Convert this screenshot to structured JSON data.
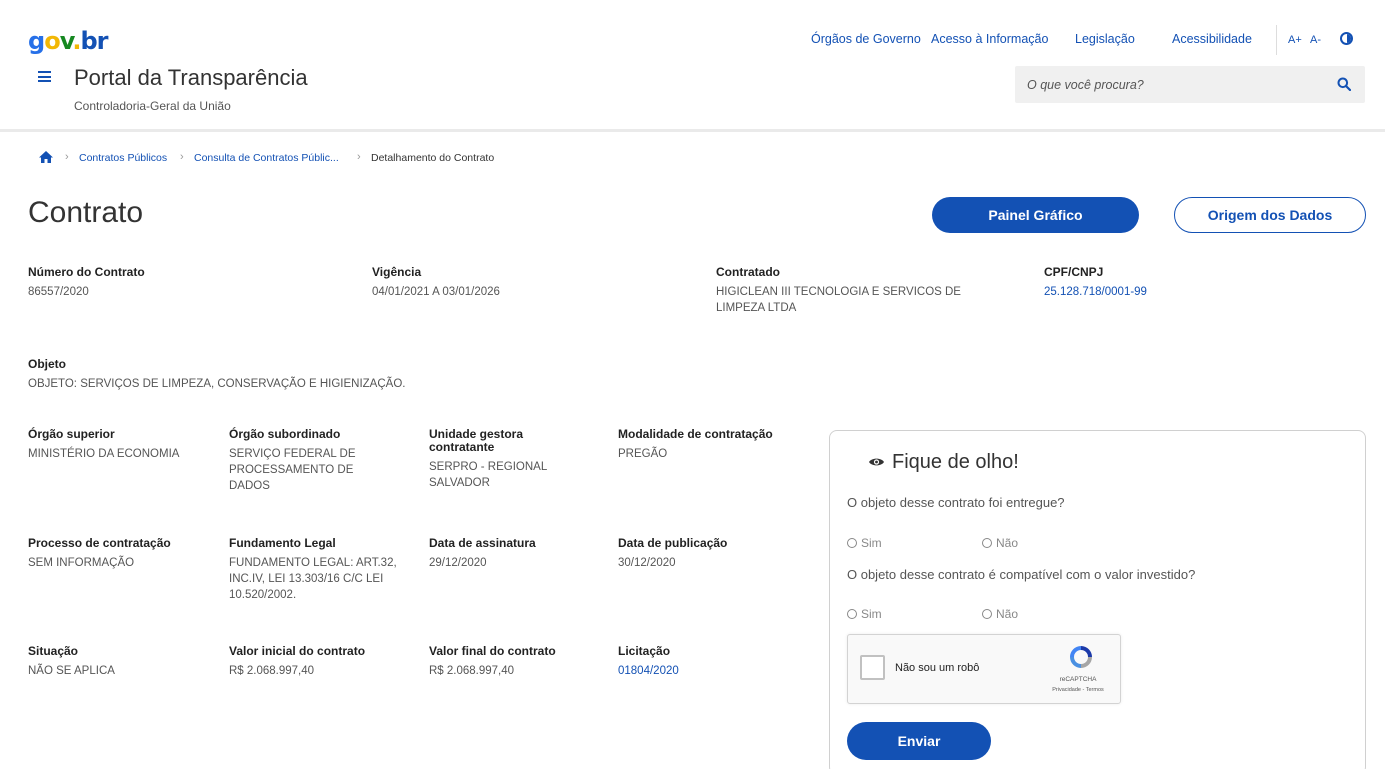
{
  "header": {
    "logo": {
      "g": "g",
      "o": "o",
      "v": "v",
      "dot": ".",
      "br": "br"
    },
    "site_title": "Portal da Transparência",
    "site_subtitle": "Controladoria-Geral da União",
    "links": [
      "Órgãos de Governo",
      "Acesso à Informação",
      "Legislação",
      "Acessibilidade"
    ],
    "font_increase": "A+",
    "font_decrease": "A-",
    "search": {
      "placeholder": "O que você procura?"
    }
  },
  "breadcrumb": {
    "items": [
      "Contratos Públicos",
      "Consulta de Contratos Públic...",
      "Detalhamento do Contrato"
    ]
  },
  "page": {
    "title": "Contrato",
    "btn_painel": "Painel Gráfico",
    "btn_origem": "Origem dos Dados"
  },
  "fields": {
    "numero": {
      "label": "Número do Contrato",
      "value": "86557/2020"
    },
    "vigencia": {
      "label": "Vigência",
      "value": "04/01/2021 A 03/01/2026"
    },
    "contratado": {
      "label": "Contratado",
      "value": "HIGICLEAN III TECNOLOGIA E SERVICOS DE LIMPEZA LTDA"
    },
    "cpf_cnpj": {
      "label": "CPF/CNPJ",
      "value": "25.128.718/0001-99"
    },
    "objeto": {
      "label": "Objeto",
      "value": "OBJETO: SERVIÇOS DE LIMPEZA, CONSERVAÇÃO E HIGIENIZAÇÃO."
    },
    "orgao_superior": {
      "label": "Órgão superior",
      "value": "MINISTÉRIO DA ECONOMIA"
    },
    "orgao_subordinado": {
      "label": "Órgão subordinado",
      "value": "SERVIÇO FEDERAL DE PROCESSAMENTO DE DADOS"
    },
    "unidade_gestora": {
      "label": "Unidade gestora contratante",
      "value": "SERPRO - REGIONAL SALVADOR"
    },
    "modalidade": {
      "label": "Modalidade de contratação",
      "value": "PREGÃO"
    },
    "processo": {
      "label": "Processo de contratação",
      "value": "SEM INFORMAÇÃO"
    },
    "fundamento": {
      "label": "Fundamento Legal",
      "value": "FUNDAMENTO LEGAL: ART.32, INC.IV, LEI 13.303/16 C/C LEI 10.520/2002."
    },
    "data_assinatura": {
      "label": "Data de assinatura",
      "value": "29/12/2020"
    },
    "data_publicacao": {
      "label": "Data de publicação",
      "value": "30/12/2020"
    },
    "situacao": {
      "label": "Situação",
      "value": "NÃO SE APLICA"
    },
    "valor_inicial": {
      "label": "Valor inicial do contrato",
      "value": "R$ 2.068.997,40"
    },
    "valor_final": {
      "label": "Valor final do contrato",
      "value": "R$ 2.068.997,40"
    },
    "licitacao": {
      "label": "Licitação",
      "value": "01804/2020"
    }
  },
  "fique": {
    "title": "Fique de olho!",
    "q1": "O objeto desse contrato foi entregue?",
    "q2": "O objeto desse contrato é compatível com o valor investido?",
    "sim": "Sim",
    "nao": "Não",
    "captcha_label": "Não sou um robô",
    "captcha_brand": "reCAPTCHA",
    "captcha_terms": "Privacidade - Termos",
    "submit": "Enviar"
  },
  "colors": {
    "primary": "#1351b4",
    "text": "#333333"
  }
}
